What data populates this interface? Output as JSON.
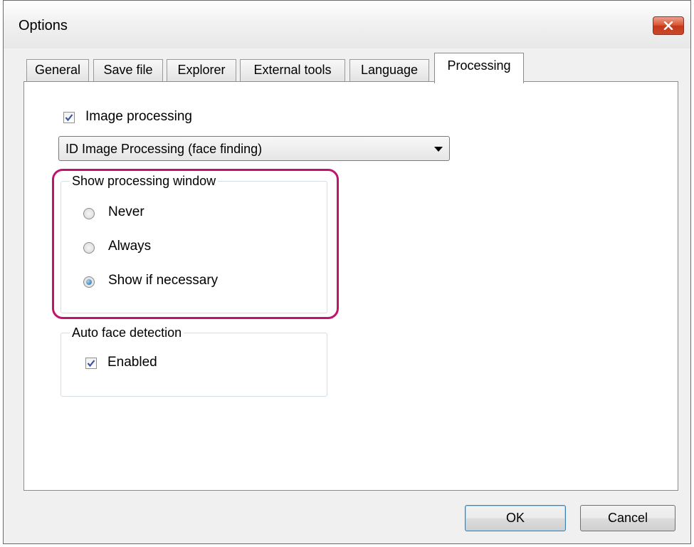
{
  "window": {
    "title": "Options"
  },
  "tabs": [
    {
      "label": "General"
    },
    {
      "label": "Save file"
    },
    {
      "label": "Explorer"
    },
    {
      "label": "External tools"
    },
    {
      "label": "Language"
    },
    {
      "label": "Processing",
      "active": true
    }
  ],
  "processing": {
    "image_processing": {
      "label": "Image processing",
      "checked": true
    },
    "method_select": {
      "value": "ID Image Processing (face finding)"
    },
    "show_window_group": {
      "title": "Show processing window",
      "options": [
        {
          "label": "Never",
          "selected": false
        },
        {
          "label": "Always",
          "selected": false
        },
        {
          "label": "Show if necessary",
          "selected": true
        }
      ]
    },
    "auto_face_group": {
      "title": "Auto face detection",
      "enabled": {
        "label": "Enabled",
        "checked": true
      }
    }
  },
  "buttons": {
    "ok": "OK",
    "cancel": "Cancel"
  },
  "colors": {
    "highlight": "#c0136c",
    "close_button": "#c9492a"
  }
}
